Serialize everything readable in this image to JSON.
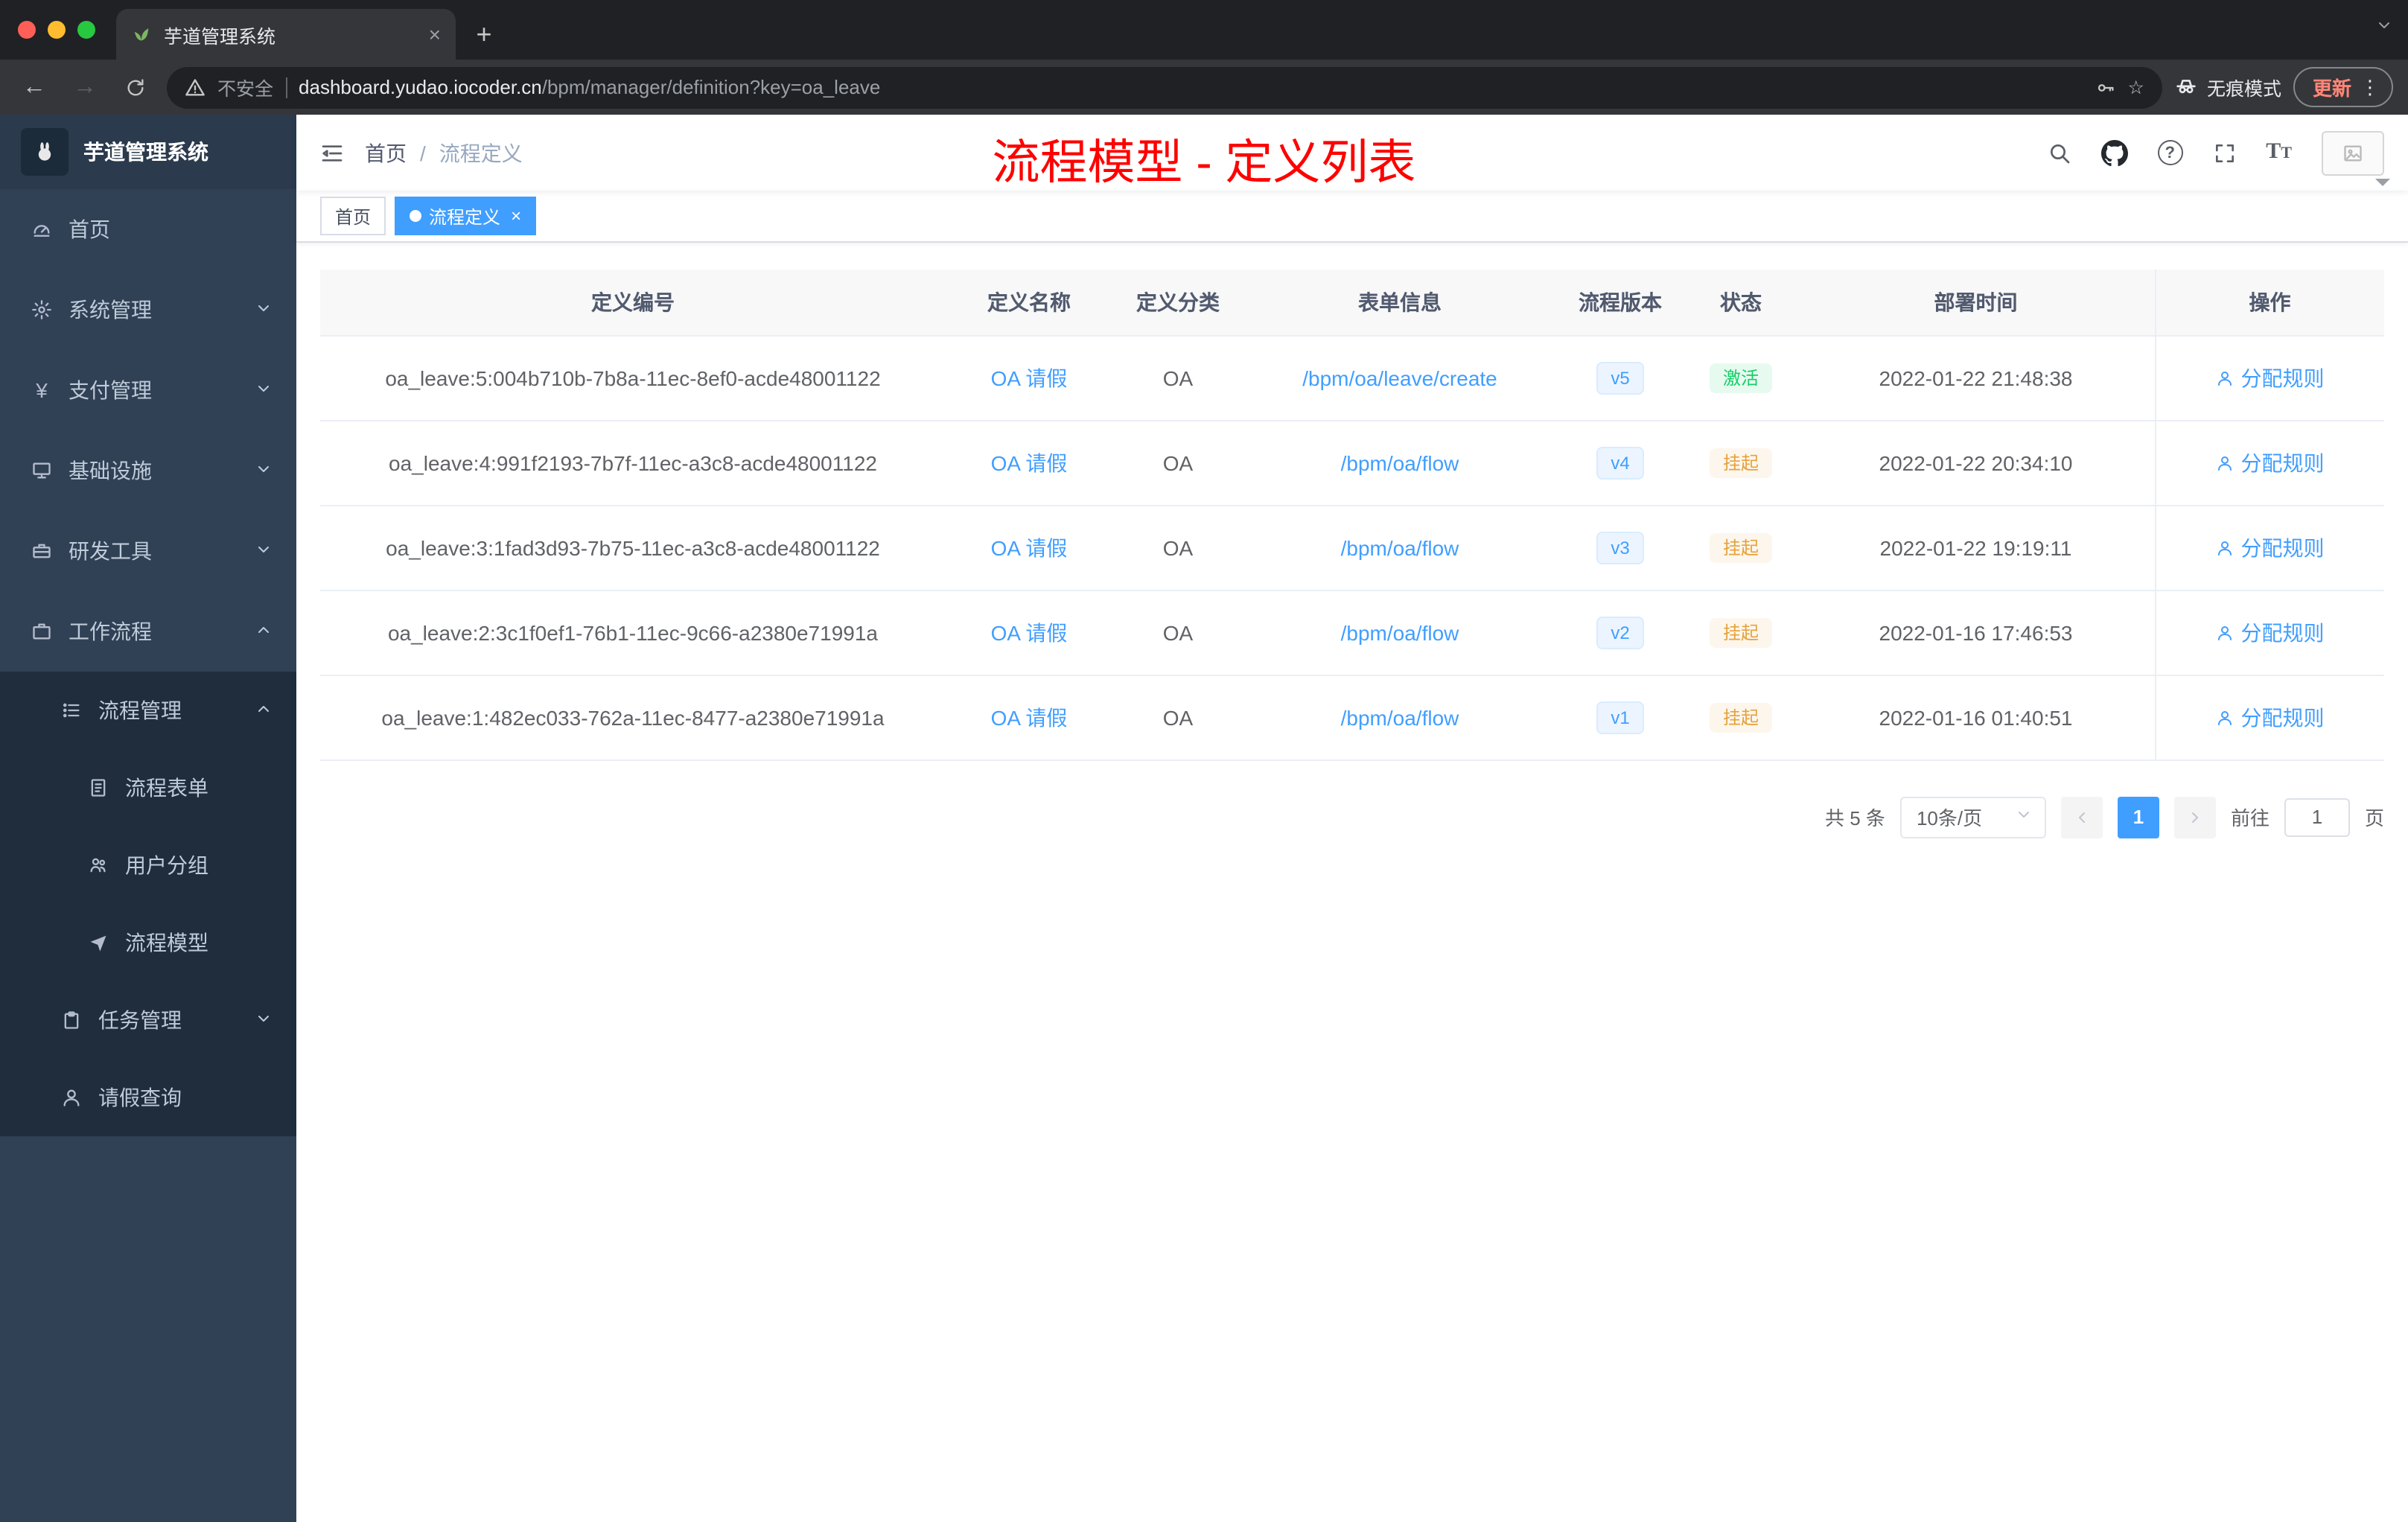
{
  "browser": {
    "tab_title": "芋道管理系统",
    "new_tab_label": "+",
    "security_label": "不安全",
    "url_host": "dashboard.yudao.iocoder.cn",
    "url_path": "/bpm/manager/definition?key=oa_leave",
    "incognito_label": "无痕模式",
    "update_label": "更新"
  },
  "sidebar": {
    "logo_title": "芋道管理系统",
    "items": [
      {
        "label": "首页"
      },
      {
        "label": "系统管理"
      },
      {
        "label": "支付管理"
      },
      {
        "label": "基础设施"
      },
      {
        "label": "研发工具"
      },
      {
        "label": "工作流程"
      },
      {
        "label": "流程管理"
      },
      {
        "label": "流程表单"
      },
      {
        "label": "用户分组"
      },
      {
        "label": "流程模型"
      },
      {
        "label": "任务管理"
      },
      {
        "label": "请假查询"
      }
    ]
  },
  "header": {
    "breadcrumb_first": "首页",
    "breadcrumb_sep": "/",
    "breadcrumb_last": "流程定义",
    "annotation": "流程模型 - 定义列表"
  },
  "tags": {
    "home_label": "首页",
    "active_label": "流程定义",
    "active_close": "×"
  },
  "table": {
    "columns": [
      "定义编号",
      "定义名称",
      "定义分类",
      "表单信息",
      "流程版本",
      "状态",
      "部署时间",
      "操作"
    ],
    "action_label": "分配规则",
    "rows": [
      {
        "id": "oa_leave:5:004b710b-7b8a-11ec-8ef0-acde48001122",
        "name": "OA 请假",
        "category": "OA",
        "form": "/bpm/oa/leave/create",
        "version": "v5",
        "status": "激活",
        "status_type": "success",
        "time": "2022-01-22 21:48:38"
      },
      {
        "id": "oa_leave:4:991f2193-7b7f-11ec-a3c8-acde48001122",
        "name": "OA 请假",
        "category": "OA",
        "form": "/bpm/oa/flow",
        "version": "v4",
        "status": "挂起",
        "status_type": "warning",
        "time": "2022-01-22 20:34:10"
      },
      {
        "id": "oa_leave:3:1fad3d93-7b75-11ec-a3c8-acde48001122",
        "name": "OA 请假",
        "category": "OA",
        "form": "/bpm/oa/flow",
        "version": "v3",
        "status": "挂起",
        "status_type": "warning",
        "time": "2022-01-22 19:19:11"
      },
      {
        "id": "oa_leave:2:3c1f0ef1-76b1-11ec-9c66-a2380e71991a",
        "name": "OA 请假",
        "category": "OA",
        "form": "/bpm/oa/flow",
        "version": "v2",
        "status": "挂起",
        "status_type": "warning",
        "time": "2022-01-16 17:46:53"
      },
      {
        "id": "oa_leave:1:482ec033-762a-11ec-8477-a2380e71991a",
        "name": "OA 请假",
        "category": "OA",
        "form": "/bpm/oa/flow",
        "version": "v1",
        "status": "挂起",
        "status_type": "warning",
        "time": "2022-01-16 01:40:51"
      }
    ]
  },
  "pagination": {
    "total_label": "共 5 条",
    "page_size_label": "10条/页",
    "current_page": "1",
    "goto_label": "前往",
    "goto_value": "1",
    "page_unit": "页"
  },
  "colors": {
    "accent": "#409eff",
    "success_text": "#13ce66",
    "warning_text": "#e6a23c",
    "annotation_red": "#fe0000",
    "sidebar_bg": "#304156",
    "submenu_bg": "#1f2d3d"
  }
}
